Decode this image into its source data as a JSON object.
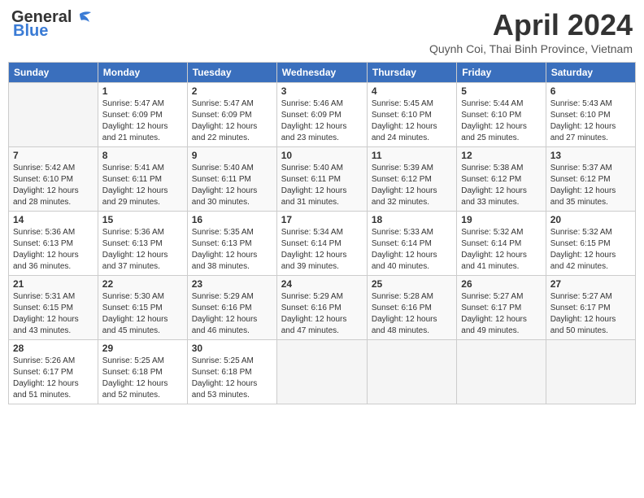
{
  "header": {
    "logo_line1": "General",
    "logo_line2": "Blue",
    "month_year": "April 2024",
    "location": "Quynh Coi, Thai Binh Province, Vietnam"
  },
  "days_of_week": [
    "Sunday",
    "Monday",
    "Tuesday",
    "Wednesday",
    "Thursday",
    "Friday",
    "Saturday"
  ],
  "weeks": [
    [
      {
        "day": "",
        "sunrise": "",
        "sunset": "",
        "daylight": ""
      },
      {
        "day": "1",
        "sunrise": "Sunrise: 5:47 AM",
        "sunset": "Sunset: 6:09 PM",
        "daylight": "Daylight: 12 hours and 21 minutes."
      },
      {
        "day": "2",
        "sunrise": "Sunrise: 5:47 AM",
        "sunset": "Sunset: 6:09 PM",
        "daylight": "Daylight: 12 hours and 22 minutes."
      },
      {
        "day": "3",
        "sunrise": "Sunrise: 5:46 AM",
        "sunset": "Sunset: 6:09 PM",
        "daylight": "Daylight: 12 hours and 23 minutes."
      },
      {
        "day": "4",
        "sunrise": "Sunrise: 5:45 AM",
        "sunset": "Sunset: 6:10 PM",
        "daylight": "Daylight: 12 hours and 24 minutes."
      },
      {
        "day": "5",
        "sunrise": "Sunrise: 5:44 AM",
        "sunset": "Sunset: 6:10 PM",
        "daylight": "Daylight: 12 hours and 25 minutes."
      },
      {
        "day": "6",
        "sunrise": "Sunrise: 5:43 AM",
        "sunset": "Sunset: 6:10 PM",
        "daylight": "Daylight: 12 hours and 27 minutes."
      }
    ],
    [
      {
        "day": "7",
        "sunrise": "Sunrise: 5:42 AM",
        "sunset": "Sunset: 6:10 PM",
        "daylight": "Daylight: 12 hours and 28 minutes."
      },
      {
        "day": "8",
        "sunrise": "Sunrise: 5:41 AM",
        "sunset": "Sunset: 6:11 PM",
        "daylight": "Daylight: 12 hours and 29 minutes."
      },
      {
        "day": "9",
        "sunrise": "Sunrise: 5:40 AM",
        "sunset": "Sunset: 6:11 PM",
        "daylight": "Daylight: 12 hours and 30 minutes."
      },
      {
        "day": "10",
        "sunrise": "Sunrise: 5:40 AM",
        "sunset": "Sunset: 6:11 PM",
        "daylight": "Daylight: 12 hours and 31 minutes."
      },
      {
        "day": "11",
        "sunrise": "Sunrise: 5:39 AM",
        "sunset": "Sunset: 6:12 PM",
        "daylight": "Daylight: 12 hours and 32 minutes."
      },
      {
        "day": "12",
        "sunrise": "Sunrise: 5:38 AM",
        "sunset": "Sunset: 6:12 PM",
        "daylight": "Daylight: 12 hours and 33 minutes."
      },
      {
        "day": "13",
        "sunrise": "Sunrise: 5:37 AM",
        "sunset": "Sunset: 6:12 PM",
        "daylight": "Daylight: 12 hours and 35 minutes."
      }
    ],
    [
      {
        "day": "14",
        "sunrise": "Sunrise: 5:36 AM",
        "sunset": "Sunset: 6:13 PM",
        "daylight": "Daylight: 12 hours and 36 minutes."
      },
      {
        "day": "15",
        "sunrise": "Sunrise: 5:36 AM",
        "sunset": "Sunset: 6:13 PM",
        "daylight": "Daylight: 12 hours and 37 minutes."
      },
      {
        "day": "16",
        "sunrise": "Sunrise: 5:35 AM",
        "sunset": "Sunset: 6:13 PM",
        "daylight": "Daylight: 12 hours and 38 minutes."
      },
      {
        "day": "17",
        "sunrise": "Sunrise: 5:34 AM",
        "sunset": "Sunset: 6:14 PM",
        "daylight": "Daylight: 12 hours and 39 minutes."
      },
      {
        "day": "18",
        "sunrise": "Sunrise: 5:33 AM",
        "sunset": "Sunset: 6:14 PM",
        "daylight": "Daylight: 12 hours and 40 minutes."
      },
      {
        "day": "19",
        "sunrise": "Sunrise: 5:32 AM",
        "sunset": "Sunset: 6:14 PM",
        "daylight": "Daylight: 12 hours and 41 minutes."
      },
      {
        "day": "20",
        "sunrise": "Sunrise: 5:32 AM",
        "sunset": "Sunset: 6:15 PM",
        "daylight": "Daylight: 12 hours and 42 minutes."
      }
    ],
    [
      {
        "day": "21",
        "sunrise": "Sunrise: 5:31 AM",
        "sunset": "Sunset: 6:15 PM",
        "daylight": "Daylight: 12 hours and 43 minutes."
      },
      {
        "day": "22",
        "sunrise": "Sunrise: 5:30 AM",
        "sunset": "Sunset: 6:15 PM",
        "daylight": "Daylight: 12 hours and 45 minutes."
      },
      {
        "day": "23",
        "sunrise": "Sunrise: 5:29 AM",
        "sunset": "Sunset: 6:16 PM",
        "daylight": "Daylight: 12 hours and 46 minutes."
      },
      {
        "day": "24",
        "sunrise": "Sunrise: 5:29 AM",
        "sunset": "Sunset: 6:16 PM",
        "daylight": "Daylight: 12 hours and 47 minutes."
      },
      {
        "day": "25",
        "sunrise": "Sunrise: 5:28 AM",
        "sunset": "Sunset: 6:16 PM",
        "daylight": "Daylight: 12 hours and 48 minutes."
      },
      {
        "day": "26",
        "sunrise": "Sunrise: 5:27 AM",
        "sunset": "Sunset: 6:17 PM",
        "daylight": "Daylight: 12 hours and 49 minutes."
      },
      {
        "day": "27",
        "sunrise": "Sunrise: 5:27 AM",
        "sunset": "Sunset: 6:17 PM",
        "daylight": "Daylight: 12 hours and 50 minutes."
      }
    ],
    [
      {
        "day": "28",
        "sunrise": "Sunrise: 5:26 AM",
        "sunset": "Sunset: 6:17 PM",
        "daylight": "Daylight: 12 hours and 51 minutes."
      },
      {
        "day": "29",
        "sunrise": "Sunrise: 5:25 AM",
        "sunset": "Sunset: 6:18 PM",
        "daylight": "Daylight: 12 hours and 52 minutes."
      },
      {
        "day": "30",
        "sunrise": "Sunrise: 5:25 AM",
        "sunset": "Sunset: 6:18 PM",
        "daylight": "Daylight: 12 hours and 53 minutes."
      },
      {
        "day": "",
        "sunrise": "",
        "sunset": "",
        "daylight": ""
      },
      {
        "day": "",
        "sunrise": "",
        "sunset": "",
        "daylight": ""
      },
      {
        "day": "",
        "sunrise": "",
        "sunset": "",
        "daylight": ""
      },
      {
        "day": "",
        "sunrise": "",
        "sunset": "",
        "daylight": ""
      }
    ]
  ]
}
